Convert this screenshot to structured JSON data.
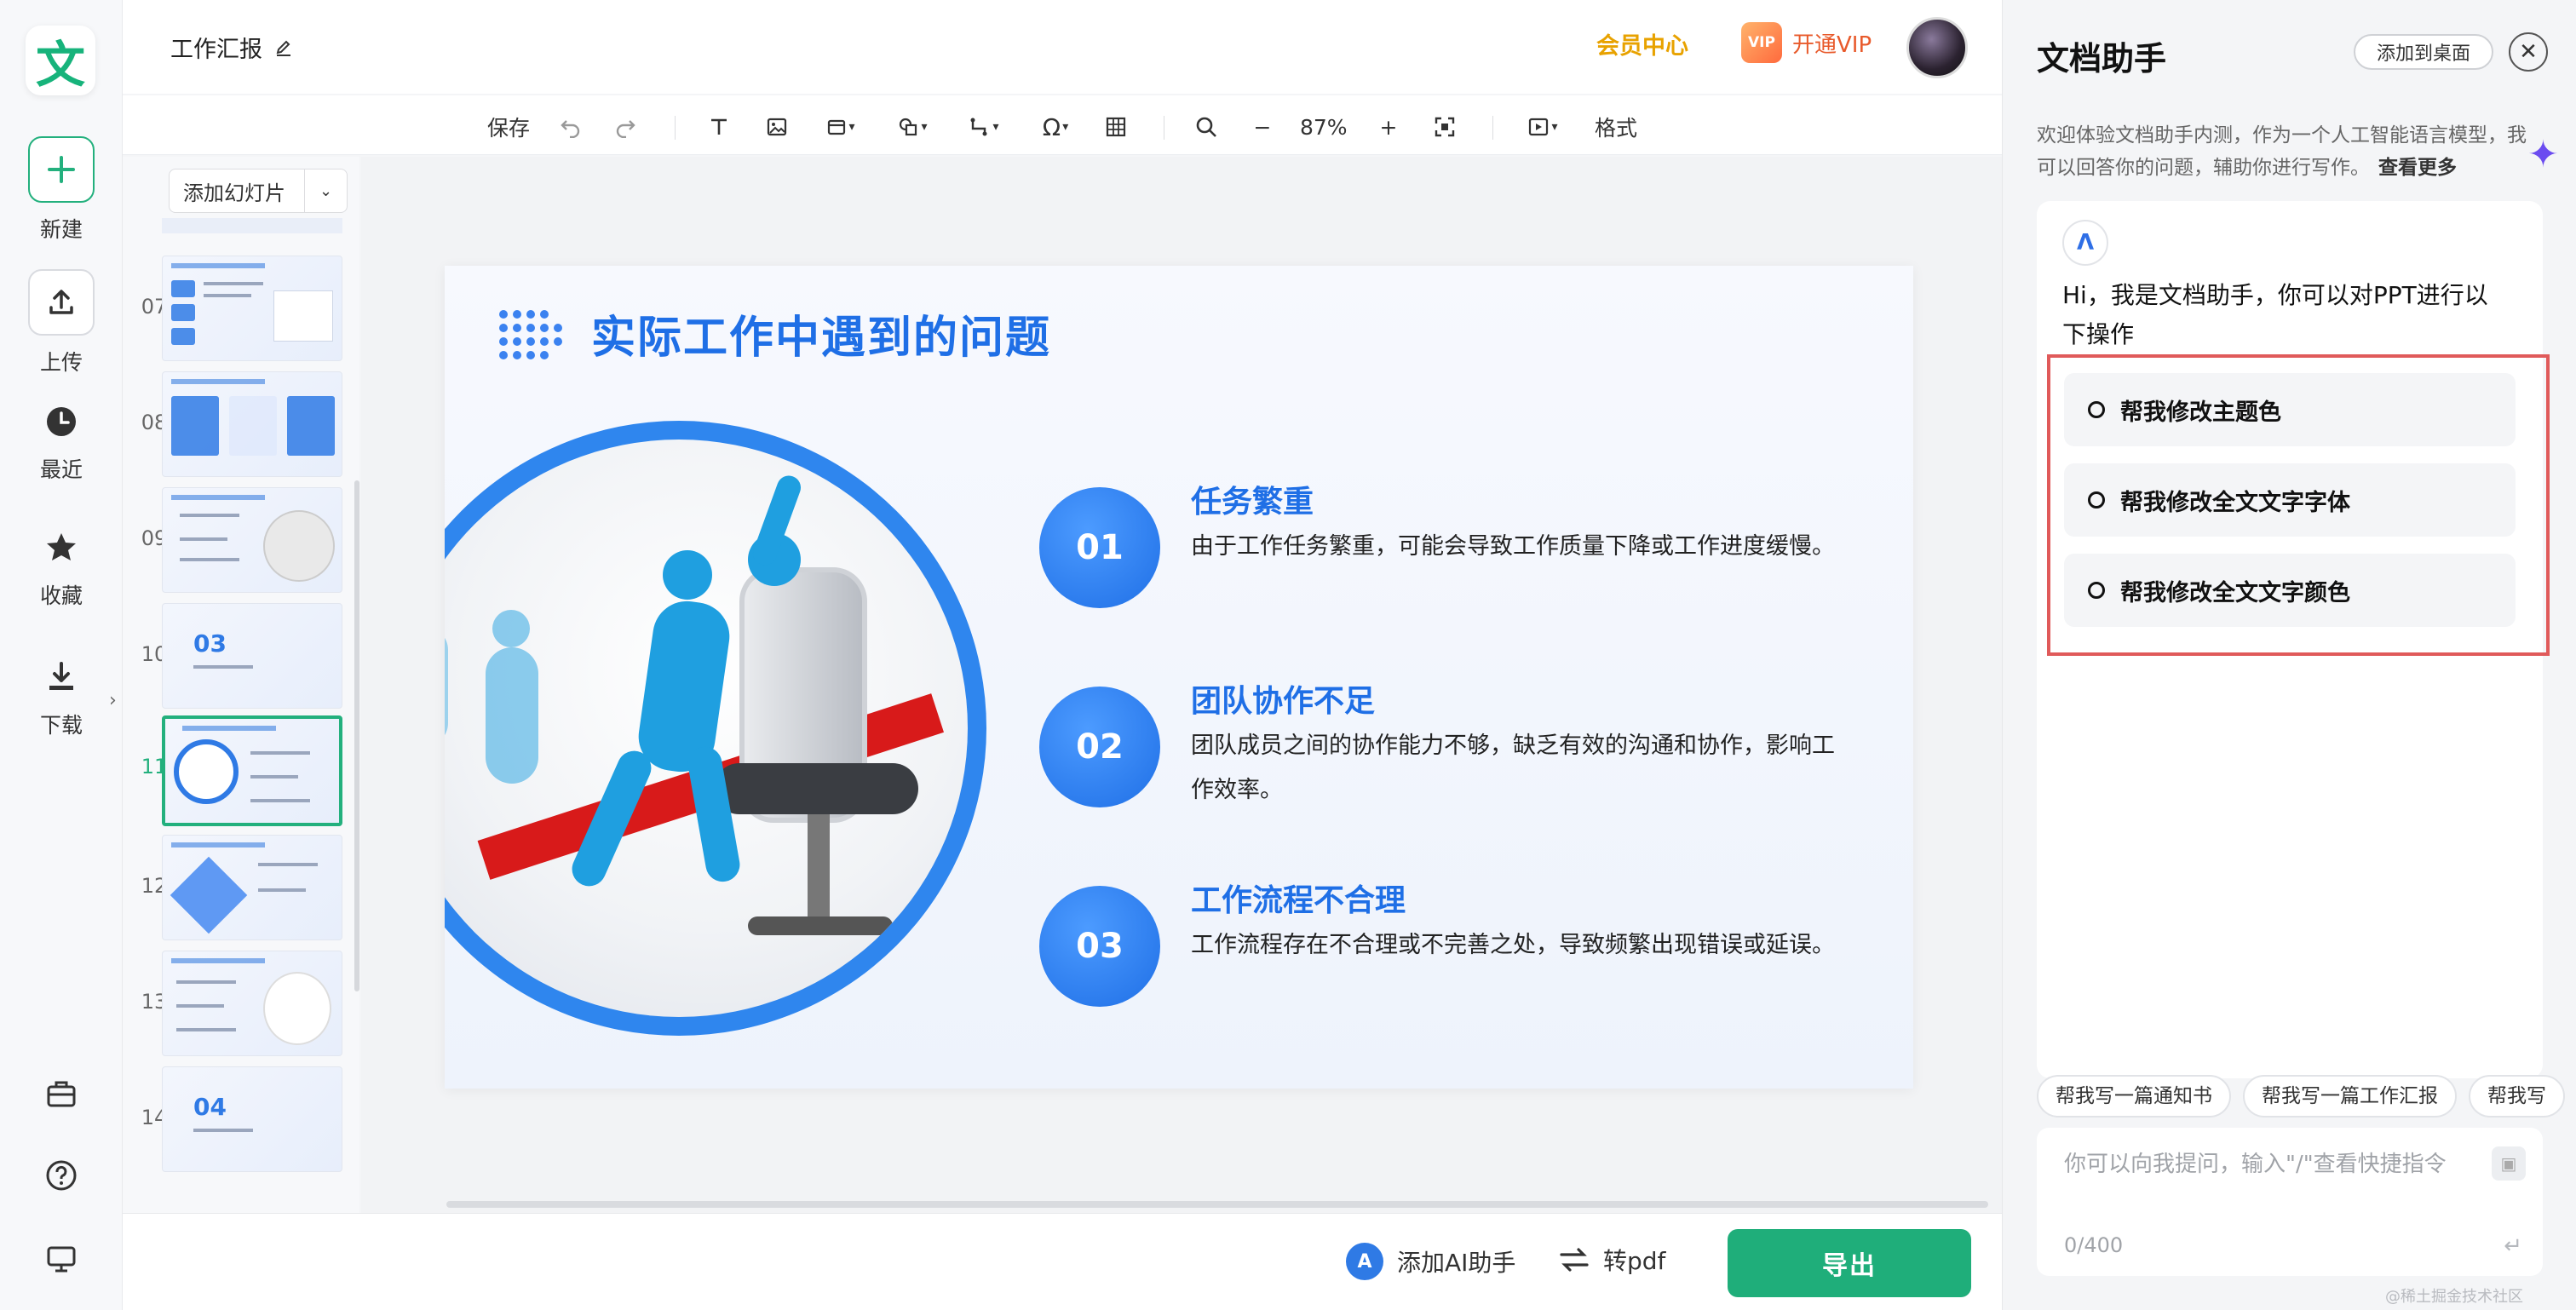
{
  "rail": {
    "logo_char": "文",
    "items": [
      {
        "label": "新建",
        "icon": "plus-icon"
      },
      {
        "label": "上传",
        "icon": "upload-icon"
      },
      {
        "label": "最近",
        "icon": "clock-icon"
      },
      {
        "label": "收藏",
        "icon": "star-icon"
      },
      {
        "label": "下载",
        "icon": "download-icon"
      }
    ],
    "collapse_glyph": "›"
  },
  "header": {
    "doc_title": "工作汇报",
    "member_center": "会员中心",
    "vip_badge": "VIP",
    "open_vip": "开通VIP"
  },
  "toolbar": {
    "save": "保存",
    "zoom_minus": "−",
    "zoom": "87%",
    "zoom_plus": "+",
    "format": "格式"
  },
  "slides_panel": {
    "add_slide": "添加幻灯片",
    "thumbs": [
      {
        "num": "07"
      },
      {
        "num": "08"
      },
      {
        "num": "09"
      },
      {
        "num": "10",
        "big": "03"
      },
      {
        "num": "11"
      },
      {
        "num": "12"
      },
      {
        "num": "13"
      },
      {
        "num": "14",
        "big": "04"
      }
    ]
  },
  "slide": {
    "title": "实际工作中遇到的问题",
    "items": [
      {
        "num": "01",
        "head": "任务繁重",
        "body": "由于工作任务繁重，可能会导致工作质量下降或工作进度缓慢。"
      },
      {
        "num": "02",
        "head": "团队协作不足",
        "body": "团队成员之间的协作能力不够，缺乏有效的沟通和协作，影响工作效率。"
      },
      {
        "num": "03",
        "head": "工作流程不合理",
        "body": "工作流程存在不合理或不完善之处，导致频繁出现错误或延误。"
      }
    ]
  },
  "bottombar": {
    "ai_helper": "添加AI助手",
    "to_pdf": "转pdf",
    "export": "导出"
  },
  "assistant": {
    "title": "文档助手",
    "add_desktop": "添加到桌面",
    "intro": "欢迎体验文档助手内测，作为一个人工智能语言模型，我可以回答你的问题，辅助你进行写作。",
    "see_more": "查看更多",
    "greeting": "Hi，我是文档助手，你可以对PPT进行以下操作",
    "options": [
      "帮我修改主题色",
      "帮我修改全文文字字体",
      "帮我修改全文文字颜色"
    ],
    "chips": [
      "帮我写一篇通知书",
      "帮我写一篇工作汇报",
      "帮我写"
    ],
    "input_placeholder": "你可以向我提问，输入\"/\"查看快捷指令",
    "char_count": "0/400",
    "send_glyph": "↵"
  },
  "watermark": "@稀土掘金技术社区",
  "colors": {
    "brand_green": "#1fae7a",
    "slide_blue": "#1f6fe6",
    "member_gold": "#e8a200",
    "highlight_red": "#e05a5a"
  }
}
